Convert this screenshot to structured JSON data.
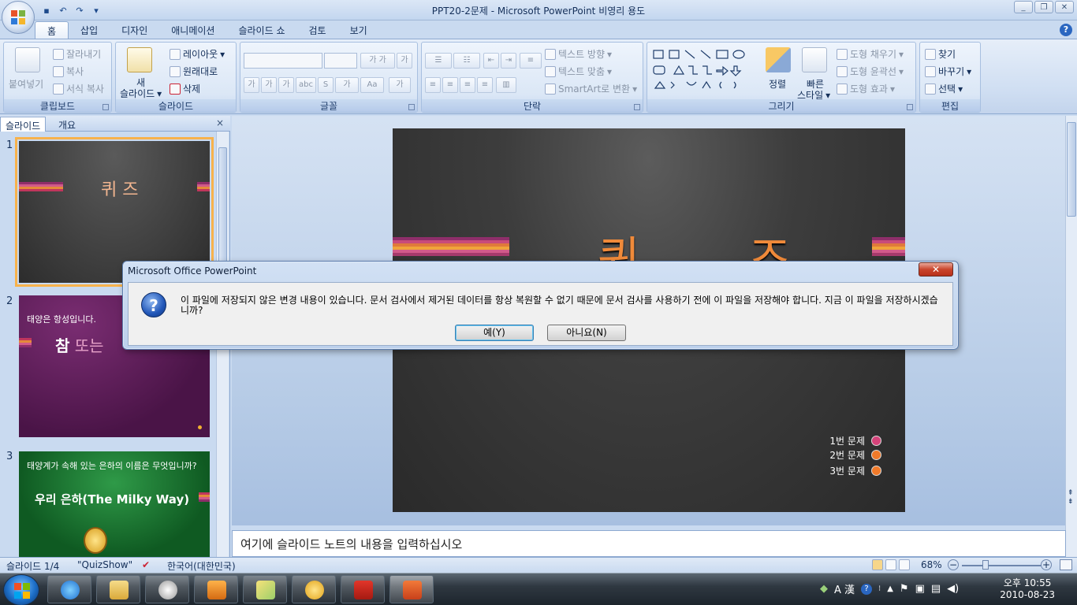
{
  "window": {
    "title": "PPT20-2문제 - Microsoft PowerPoint 비영리 용도",
    "controls": [
      "minimize-icon",
      "restore-icon",
      "close-icon"
    ]
  },
  "ribbon_tabs": [
    "홈",
    "삽입",
    "디자인",
    "애니메이션",
    "슬라이드 쇼",
    "검토",
    "보기"
  ],
  "ribbon": {
    "clipboard": {
      "label": "클립보드",
      "paste": "붙여넣기",
      "cut": "잘라내기",
      "copy": "복사",
      "format_painter": "서식 복사"
    },
    "slides": {
      "label": "슬라이드",
      "new_slide_line1": "새",
      "new_slide_line2": "슬라이드",
      "layout": "레이아웃",
      "reset": "원래대로",
      "delete": "삭제"
    },
    "font": {
      "label": "글꼴"
    },
    "paragraph": {
      "label": "단락",
      "text_direction": "텍스트 방향",
      "align_text": "텍스트 맞춤",
      "smartart": "SmartArt로 변환"
    },
    "drawing": {
      "label": "그리기",
      "arrange": "정렬",
      "quick_styles_line1": "빠른",
      "quick_styles_line2": "스타일",
      "shape_fill": "도형 채우기",
      "shape_outline": "도형 윤곽선",
      "shape_effects": "도형 효과"
    },
    "editing": {
      "label": "편집",
      "find": "찾기",
      "replace": "바꾸기",
      "select": "선택"
    }
  },
  "slide_pane": {
    "tabs": [
      "슬라이드",
      "개요"
    ],
    "close": "×",
    "thumbnails": [
      {
        "num": "1",
        "title": "퀴 즈"
      },
      {
        "num": "2",
        "line1": "태양은 항성입니다.",
        "line2_a": "참",
        "line2_b": " 또는"
      },
      {
        "num": "3",
        "line1": "태양계가 속해 있는 은하의 이름은 무엇입니까?",
        "line2": "우리 은하(The Milky Way)"
      }
    ]
  },
  "slide": {
    "title": "퀴 즈",
    "links": [
      {
        "label": "1번 문제",
        "color": "#d4437a"
      },
      {
        "label": "2번 문제",
        "color": "#f07a2a"
      },
      {
        "label": "3번 문제",
        "color": "#f07a2a"
      }
    ]
  },
  "notes": {
    "placeholder": "여기에 슬라이드 노트의 내용을 입력하십시오"
  },
  "status": {
    "slide": "슬라이드 1/4",
    "theme": "\"QuizShow\"",
    "language": "한국어(대한민국)",
    "zoom": "68%"
  },
  "dialog": {
    "title": "Microsoft Office PowerPoint",
    "message": "이 파일에 저장되지 않은 변경 내용이 있습니다. 문서 검사에서 제거된 데이터를 항상 복원할 수 없기 때문에 문서 검사를 사용하기 전에 이 파일을 저장해야 합니다. 지금 이 파일을 저장하시겠습니까?",
    "yes": "예(Y)",
    "no": "아니요(N)",
    "close": "✕"
  },
  "taskbar": {
    "time": "오후 10:55",
    "date": "2010-08-23",
    "ime": "A 漢"
  },
  "colors": {
    "accent": "#f08a3a",
    "ribbon_bg": "#dbe7f6",
    "slide_bg": "#3d3d3d"
  }
}
